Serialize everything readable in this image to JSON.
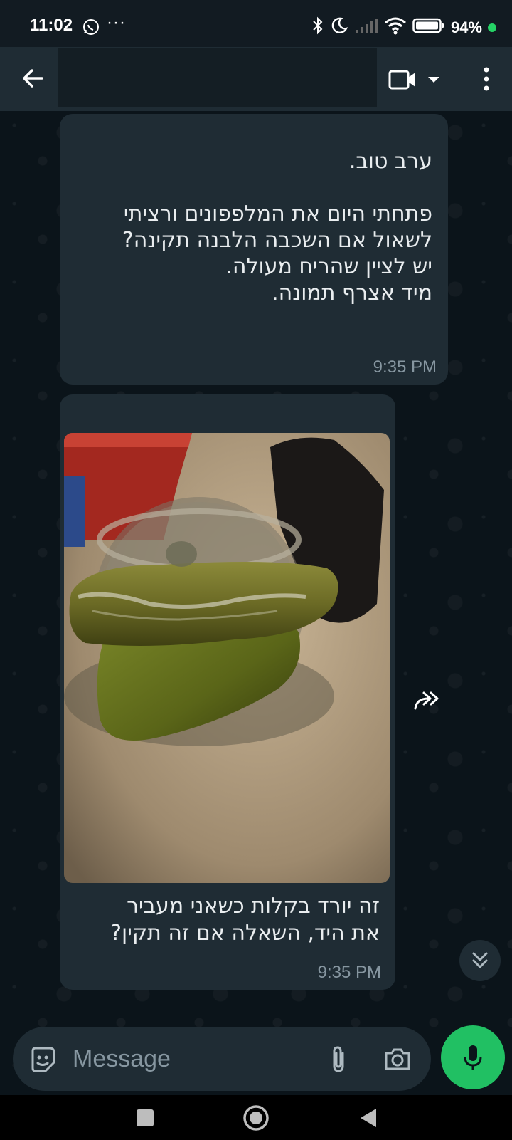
{
  "status_bar": {
    "time": "11:02",
    "more_indicator": "···",
    "battery": "94%",
    "icons": [
      "whatsapp-icon",
      "bluetooth-icon",
      "moon-icon",
      "signal-icon",
      "wifi-icon",
      "battery-icon"
    ]
  },
  "header": {
    "contact_name": "",
    "icons": [
      "back-arrow-icon",
      "video-call-icon",
      "dropdown-icon",
      "more-vert-icon"
    ]
  },
  "messages": [
    {
      "lines": [
        "ערב טוב.",
        "",
        "פתחתי היום את המלפפונים ורציתי",
        "לשאול אם השכבה הלבנה תקינה?",
        "יש לציין שהריח מעולה.",
        "מיד אצרף תמונה."
      ],
      "time": "9:35 PM"
    },
    {
      "image": "photo-pickles-jar",
      "lines": [
        "זה יורד בקלות כשאני מעביר",
        "את היד, השאלה אם זה תקין?"
      ],
      "time": "9:35 PM"
    }
  ],
  "composer": {
    "placeholder": "Message",
    "icons": [
      "emoji-sticker-icon",
      "attach-icon",
      "camera-icon",
      "mic-icon"
    ]
  },
  "colors": {
    "background": "#0b141a",
    "bubble": "#1f2c34",
    "accent": "#21c063",
    "meta_text": "#8696a0"
  }
}
